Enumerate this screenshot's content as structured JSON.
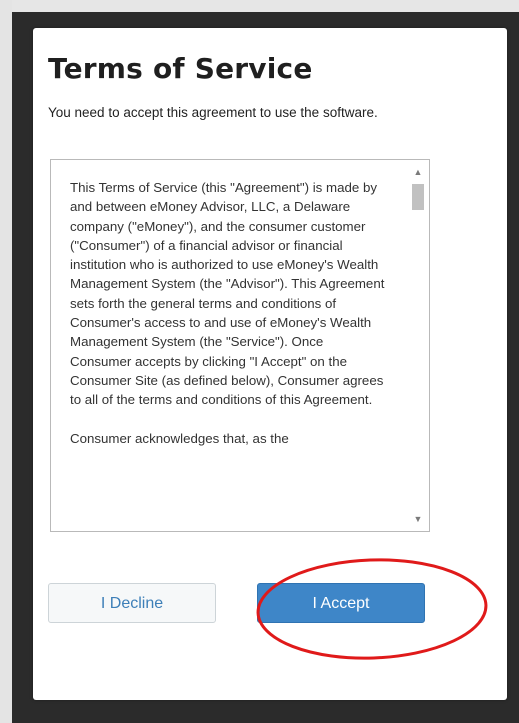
{
  "dialog": {
    "title": "Terms of Service",
    "subtitle": "You need to accept this agreement to use the software."
  },
  "terms": {
    "paragraphs": [
      "This Terms of Service (this \"Agreement\") is made by and between eMoney Advisor, LLC, a Delaware company (\"eMoney\"), and the consumer customer (\"Consumer\") of a financial advisor or financial institution who is authorized to use eMoney's Wealth Management System (the \"Advisor\"). This Agreement sets forth the general terms and conditions of Consumer's access to and use of eMoney's Wealth Management System (the \"Service\"). Once Consumer accepts by clicking \"I Accept\" on the Consumer Site (as defined below), Consumer agrees to all of the terms and conditions of this Agreement.",
      "Consumer acknowledges that, as the"
    ]
  },
  "scrollbar": {
    "up_glyph": "▲",
    "down_glyph": "▼",
    "position_fraction": 0.0
  },
  "buttons": {
    "decline_label": "I Decline",
    "accept_label": "I Accept"
  },
  "colors": {
    "accent": "#3e86c8",
    "decline_text": "#3d7fb8",
    "highlight": "#e01a1a"
  }
}
